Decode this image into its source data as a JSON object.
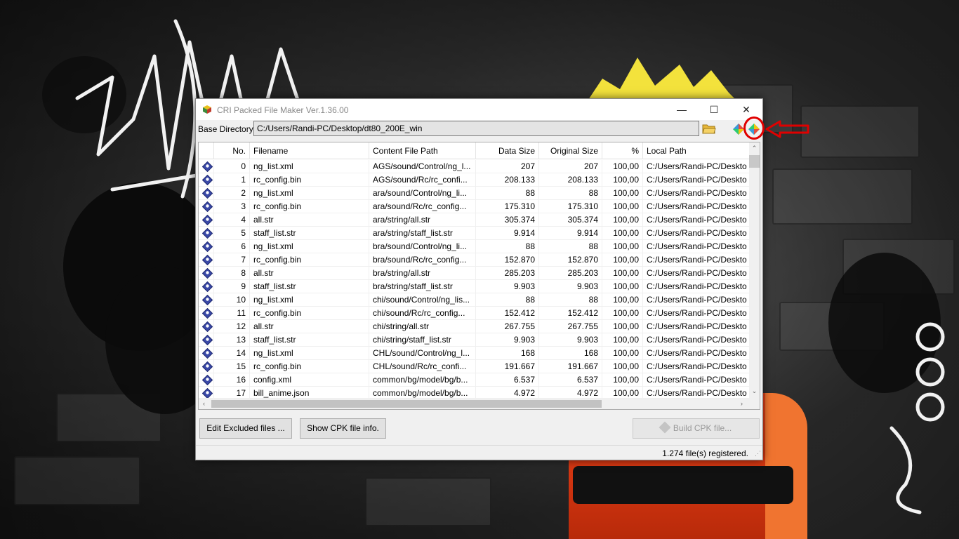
{
  "window": {
    "title": "CRI Packed File Maker Ver.1.36.00",
    "controls": {
      "minimize": "—",
      "maximize": "☐",
      "close": "✕"
    }
  },
  "base_directory": {
    "label": "Base Directory",
    "value": "C:/Users/Randi-PC/Desktop/dt80_200E_win"
  },
  "icons": {
    "app": "cri-app-icon",
    "folder": "open-folder-icon",
    "toolbar": [
      "cpk-tool-icon",
      "cpk-settings-icon"
    ],
    "row": "cpk-file-icon"
  },
  "table": {
    "columns": [
      "No.",
      "Filename",
      "Content File Path",
      "Data Size",
      "Original Size",
      "%",
      "Local Path"
    ],
    "rows": [
      {
        "no": "0",
        "filename": "ng_list.xml",
        "path": "AGS/sound/Control/ng_l...",
        "data_size": "207",
        "orig_size": "207",
        "pct": "100,00",
        "local": "C:/Users/Randi-PC/Deskto"
      },
      {
        "no": "1",
        "filename": "rc_config.bin",
        "path": "AGS/sound/Rc/rc_confi...",
        "data_size": "208.133",
        "orig_size": "208.133",
        "pct": "100,00",
        "local": "C:/Users/Randi-PC/Deskto"
      },
      {
        "no": "2",
        "filename": "ng_list.xml",
        "path": "ara/sound/Control/ng_li...",
        "data_size": "88",
        "orig_size": "88",
        "pct": "100,00",
        "local": "C:/Users/Randi-PC/Deskto"
      },
      {
        "no": "3",
        "filename": "rc_config.bin",
        "path": "ara/sound/Rc/rc_config...",
        "data_size": "175.310",
        "orig_size": "175.310",
        "pct": "100,00",
        "local": "C:/Users/Randi-PC/Deskto"
      },
      {
        "no": "4",
        "filename": "all.str",
        "path": "ara/string/all.str",
        "data_size": "305.374",
        "orig_size": "305.374",
        "pct": "100,00",
        "local": "C:/Users/Randi-PC/Deskto"
      },
      {
        "no": "5",
        "filename": "staff_list.str",
        "path": "ara/string/staff_list.str",
        "data_size": "9.914",
        "orig_size": "9.914",
        "pct": "100,00",
        "local": "C:/Users/Randi-PC/Deskto"
      },
      {
        "no": "6",
        "filename": "ng_list.xml",
        "path": "bra/sound/Control/ng_li...",
        "data_size": "88",
        "orig_size": "88",
        "pct": "100,00",
        "local": "C:/Users/Randi-PC/Deskto"
      },
      {
        "no": "7",
        "filename": "rc_config.bin",
        "path": "bra/sound/Rc/rc_config...",
        "data_size": "152.870",
        "orig_size": "152.870",
        "pct": "100,00",
        "local": "C:/Users/Randi-PC/Deskto"
      },
      {
        "no": "8",
        "filename": "all.str",
        "path": "bra/string/all.str",
        "data_size": "285.203",
        "orig_size": "285.203",
        "pct": "100,00",
        "local": "C:/Users/Randi-PC/Deskto"
      },
      {
        "no": "9",
        "filename": "staff_list.str",
        "path": "bra/string/staff_list.str",
        "data_size": "9.903",
        "orig_size": "9.903",
        "pct": "100,00",
        "local": "C:/Users/Randi-PC/Deskto"
      },
      {
        "no": "10",
        "filename": "ng_list.xml",
        "path": "chi/sound/Control/ng_lis...",
        "data_size": "88",
        "orig_size": "88",
        "pct": "100,00",
        "local": "C:/Users/Randi-PC/Deskto"
      },
      {
        "no": "11",
        "filename": "rc_config.bin",
        "path": "chi/sound/Rc/rc_config...",
        "data_size": "152.412",
        "orig_size": "152.412",
        "pct": "100,00",
        "local": "C:/Users/Randi-PC/Deskto"
      },
      {
        "no": "12",
        "filename": "all.str",
        "path": "chi/string/all.str",
        "data_size": "267.755",
        "orig_size": "267.755",
        "pct": "100,00",
        "local": "C:/Users/Randi-PC/Deskto"
      },
      {
        "no": "13",
        "filename": "staff_list.str",
        "path": "chi/string/staff_list.str",
        "data_size": "9.903",
        "orig_size": "9.903",
        "pct": "100,00",
        "local": "C:/Users/Randi-PC/Deskto"
      },
      {
        "no": "14",
        "filename": "ng_list.xml",
        "path": "CHL/sound/Control/ng_l...",
        "data_size": "168",
        "orig_size": "168",
        "pct": "100,00",
        "local": "C:/Users/Randi-PC/Deskto"
      },
      {
        "no": "15",
        "filename": "rc_config.bin",
        "path": "CHL/sound/Rc/rc_confi...",
        "data_size": "191.667",
        "orig_size": "191.667",
        "pct": "100,00",
        "local": "C:/Users/Randi-PC/Deskto"
      },
      {
        "no": "16",
        "filename": "config.xml",
        "path": "common/bg/model/bg/b...",
        "data_size": "6.537",
        "orig_size": "6.537",
        "pct": "100,00",
        "local": "C:/Users/Randi-PC/Deskto"
      },
      {
        "no": "17",
        "filename": "bill_anime.json",
        "path": "common/bg/model/bg/b...",
        "data_size": "4.972",
        "orig_size": "4.972",
        "pct": "100,00",
        "local": "C:/Users/Randi-PC/Deskto"
      }
    ]
  },
  "scroll": {
    "up": "⌃",
    "down": "⌄",
    "left": "‹",
    "right": "›"
  },
  "buttons": {
    "edit_excluded": "Edit Excluded files ...",
    "show_cpk_info": "Show CPK file info.",
    "build_cpk": "Build CPK file..."
  },
  "status": {
    "text": "1.274 file(s) registered."
  },
  "colors": {
    "annotation": "#e00000",
    "accent": "#0078d7"
  }
}
